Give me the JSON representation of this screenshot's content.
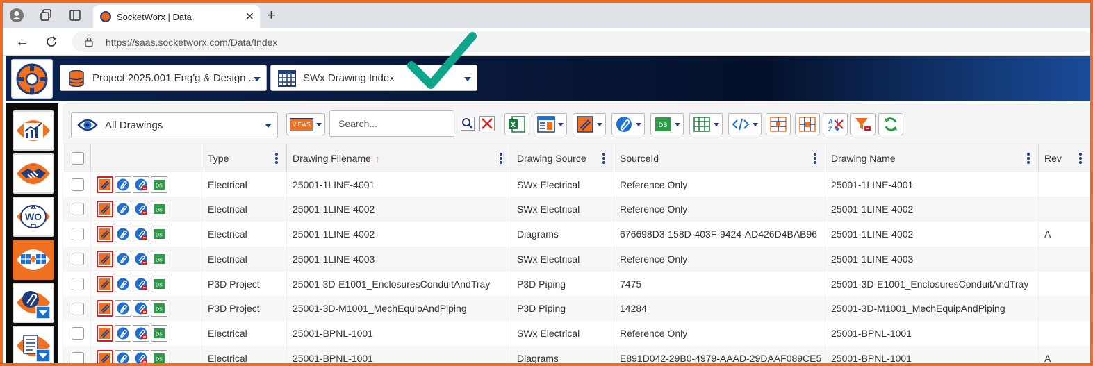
{
  "browser": {
    "tab_title": "SocketWorx | Data",
    "url": "https://saas.socketworx.com/Data/Index"
  },
  "header": {
    "project_selector": "Project 2025.001 Eng'g & Design ...",
    "index_selector": "SWx Drawing Index"
  },
  "sidebar": {
    "items": [
      {
        "icon": "dashboard-chart-icon"
      },
      {
        "icon": "handshake-icon"
      },
      {
        "icon": "work-order-icon"
      },
      {
        "icon": "data-grid-icon",
        "active": true
      },
      {
        "icon": "attachment-download-icon"
      },
      {
        "icon": "report-download-icon"
      }
    ]
  },
  "toolbar": {
    "view_selector": "All Drawings",
    "views_button": "VIEWS",
    "search_placeholder": "Search..."
  },
  "table": {
    "columns": [
      "Type",
      "Drawing Filename",
      "Drawing Source",
      "SourceId",
      "Drawing Name",
      "Rev"
    ],
    "sort_column": "Drawing Filename",
    "rows": [
      {
        "type": "Electrical",
        "filename": "25001-1LINE-4001",
        "source": "SWx Electrical",
        "sourceid": "Reference Only",
        "name": "25001-1LINE-4001",
        "rev": ""
      },
      {
        "type": "Electrical",
        "filename": "25001-1LINE-4002",
        "source": "SWx Electrical",
        "sourceid": "Reference Only",
        "name": "25001-1LINE-4002",
        "rev": ""
      },
      {
        "type": "Electrical",
        "filename": "25001-1LINE-4002",
        "source": "Diagrams",
        "sourceid": "676698D3-158D-403F-9424-AD426D4BAB96",
        "name": "25001-1LINE-4002",
        "rev": "A"
      },
      {
        "type": "Electrical",
        "filename": "25001-1LINE-4003",
        "source": "SWx Electrical",
        "sourceid": "Reference Only",
        "name": "25001-1LINE-4003",
        "rev": ""
      },
      {
        "type": "P3D Project",
        "filename": "25001-3D-E1001_EnclosuresConduitAndTray",
        "source": "P3D Piping",
        "sourceid": "7475",
        "name": "25001-3D-E1001_EnclosuresConduitAndTray",
        "rev": ""
      },
      {
        "type": "P3D Project",
        "filename": "25001-3D-M1001_MechEquipAndPiping",
        "source": "P3D Piping",
        "sourceid": "14284",
        "name": "25001-3D-M1001_MechEquipAndPiping",
        "rev": ""
      },
      {
        "type": "Electrical",
        "filename": "25001-BPNL-1001",
        "source": "SWx Electrical",
        "sourceid": "Reference Only",
        "name": "25001-BPNL-1001",
        "rev": ""
      },
      {
        "type": "Electrical",
        "filename": "25001-BPNL-1001",
        "source": "Diagrams",
        "sourceid": "E891D042-29B0-4979-AAAD-29DAAF089CE5",
        "name": "25001-BPNL-1001",
        "rev": "A"
      }
    ]
  },
  "colors": {
    "frame_orange": "#f26b1d",
    "navy": "#1f3d7a",
    "accent_orange": "#f07022",
    "checkmark_teal": "#0ea58a",
    "action_red": "#d62020",
    "ds_green": "#2e9b48"
  }
}
